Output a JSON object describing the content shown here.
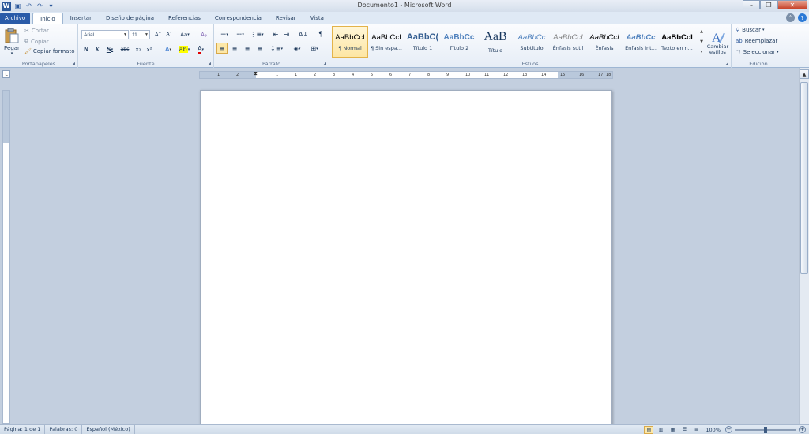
{
  "title_bar": {
    "doc_title": "Documento1 - Microsoft Word",
    "qat_icons": [
      "word-icon",
      "save-icon",
      "undo-icon",
      "redo-icon",
      "customize-icon"
    ]
  },
  "tabs": [
    {
      "label": "Archivo",
      "kind": "file"
    },
    {
      "label": "Inicio",
      "kind": "active"
    },
    {
      "label": "Insertar",
      "kind": "normal"
    },
    {
      "label": "Diseño de página",
      "kind": "normal"
    },
    {
      "label": "Referencias",
      "kind": "normal"
    },
    {
      "label": "Correspondencia",
      "kind": "normal"
    },
    {
      "label": "Revisar",
      "kind": "normal"
    },
    {
      "label": "Vista",
      "kind": "normal"
    }
  ],
  "clipboard": {
    "label": "Portapapeles",
    "paste": "Pegar",
    "cut": "Cortar",
    "copy": "Copiar",
    "format_painter": "Copiar formato"
  },
  "font": {
    "label": "Fuente",
    "family": "Arial",
    "size": "11",
    "bold": "N",
    "italic": "K",
    "underline": "S",
    "strike": "abc",
    "subscript": "x₂",
    "superscript": "x²",
    "grow": "A˄",
    "shrink": "A˅",
    "change_case": "Aa",
    "font_color": "A"
  },
  "paragraph": {
    "label": "Párrafo",
    "show_marks": "¶"
  },
  "styles": {
    "label": "Estilos",
    "items": [
      {
        "preview": "AaBbCcI",
        "name": "¶ Normal",
        "color": "#000000",
        "size": "9.5px",
        "weight": "normal",
        "style": "normal",
        "selected": true
      },
      {
        "preview": "AaBbCcI",
        "name": "¶ Sin espa...",
        "color": "#000000",
        "size": "9.5px",
        "weight": "normal",
        "style": "normal",
        "selected": false
      },
      {
        "preview": "AaBbC(",
        "name": "Título 1",
        "color": "#365f91",
        "size": "11px",
        "weight": "bold",
        "style": "normal",
        "selected": false
      },
      {
        "preview": "AaBbCc",
        "name": "Título 2",
        "color": "#4f81bd",
        "size": "10px",
        "weight": "bold",
        "style": "normal",
        "selected": false
      },
      {
        "preview": "AaB",
        "name": "Título",
        "color": "#17365d",
        "size": "16px",
        "weight": "normal",
        "style": "normal",
        "selected": false
      },
      {
        "preview": "AaBbCc",
        "name": "Subtítulo",
        "color": "#4f81bd",
        "size": "9.5px",
        "weight": "normal",
        "style": "italic",
        "selected": false
      },
      {
        "preview": "AaBbCcI",
        "name": "Énfasis sutil",
        "color": "#808080",
        "size": "9.5px",
        "weight": "normal",
        "style": "italic",
        "selected": false
      },
      {
        "preview": "AaBbCcI",
        "name": "Énfasis",
        "color": "#000000",
        "size": "9.5px",
        "weight": "normal",
        "style": "italic",
        "selected": false
      },
      {
        "preview": "AaBbCc",
        "name": "Énfasis int...",
        "color": "#4f81bd",
        "size": "9.5px",
        "weight": "bold",
        "style": "italic",
        "selected": false
      },
      {
        "preview": "AaBbCcI",
        "name": "Texto en n...",
        "color": "#000000",
        "size": "9.5px",
        "weight": "bold",
        "style": "normal",
        "selected": false
      }
    ],
    "change_styles": "Cambiar estilos"
  },
  "editing": {
    "label": "Edición",
    "find": "Buscar",
    "replace": "Reemplazar",
    "select": "Seleccionar"
  },
  "ruler": {
    "corner": "L",
    "ticks": [
      "1",
      "2",
      "1",
      "1",
      "2",
      "3",
      "4",
      "5",
      "6",
      "7",
      "8",
      "9",
      "10",
      "11",
      "12",
      "13",
      "14",
      "15",
      "16",
      "17",
      "18"
    ]
  },
  "status": {
    "page": "Página: 1 de 1",
    "words": "Palabras: 0",
    "language": "Español (México)",
    "zoom": "100%"
  },
  "colors": {
    "file_tab": "#2a5ba8",
    "accent": "#2b579a",
    "highlight": "#fde8a8"
  }
}
